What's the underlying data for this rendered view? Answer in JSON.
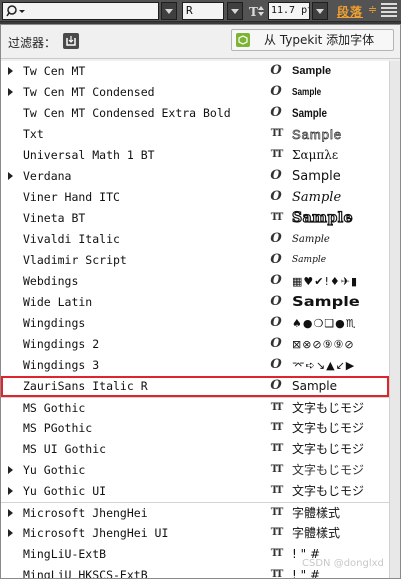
{
  "toolbar": {
    "font_search_value": "",
    "style_value": "R",
    "size_value": "11.7 pt",
    "paragraph_label": "段落",
    "paragraph_arrow": "≑"
  },
  "filter": {
    "label": "过滤器：",
    "typekit_button": "从 Typekit 添加字体"
  },
  "fonts": [
    {
      "name": "Tw Cen MT",
      "expandable": true,
      "type": "O",
      "sample": "Sample",
      "sample_style": "bold-sans"
    },
    {
      "name": "Tw Cen MT Condensed",
      "expandable": true,
      "type": "O",
      "sample": "Sample",
      "sample_style": "condensed"
    },
    {
      "name": "Tw Cen MT Condensed Extra Bold",
      "expandable": false,
      "type": "O",
      "sample": "Sample",
      "sample_style": "condensed-bold"
    },
    {
      "name": "Txt",
      "expandable": false,
      "type": "TT",
      "sample": "Sample",
      "sample_style": "outline"
    },
    {
      "name": "Universal Math 1 BT",
      "expandable": false,
      "type": "TT",
      "sample": "Σαμπλε",
      "sample_style": "greek"
    },
    {
      "name": "Verdana",
      "expandable": true,
      "type": "O",
      "sample": "Sample",
      "sample_style": "verdana"
    },
    {
      "name": "Viner Hand ITC",
      "expandable": false,
      "type": "O",
      "sample": "Sample",
      "sample_style": "hand"
    },
    {
      "name": "Vineta BT",
      "expandable": false,
      "type": "TT",
      "sample": "Sample",
      "sample_style": "vineta"
    },
    {
      "name": "Vivaldi Italic",
      "expandable": false,
      "type": "O",
      "sample": "Sample",
      "sample_style": "script-small"
    },
    {
      "name": "Vladimir Script",
      "expandable": false,
      "type": "O",
      "sample": "Sample",
      "sample_style": "script-tiny"
    },
    {
      "name": "Webdings",
      "expandable": false,
      "type": "O",
      "sample": "▦♥✔!♦✈▮",
      "sample_style": "symbols"
    },
    {
      "name": "Wide Latin",
      "expandable": false,
      "type": "O",
      "sample": "Sample",
      "sample_style": "wide"
    },
    {
      "name": "Wingdings",
      "expandable": false,
      "type": "O",
      "sample": "♠●❍❑●♏",
      "sample_style": "symbols"
    },
    {
      "name": "Wingdings 2",
      "expandable": false,
      "type": "O",
      "sample": "⊠⊗⊘⑨⑨⊘",
      "sample_style": "symbols"
    },
    {
      "name": "Wingdings 3",
      "expandable": false,
      "type": "O",
      "sample": "⌤➪↘▲↙▶",
      "sample_style": "symbols"
    },
    {
      "name": "ZauriSans Italic R",
      "expandable": false,
      "type": "O",
      "sample": "Sample",
      "sample_style": "plain",
      "selected": true
    },
    {
      "name": "MS Gothic",
      "expandable": false,
      "type": "TT",
      "sample": "文字もじモジ",
      "sample_style": "cjk",
      "separator": true
    },
    {
      "name": "MS PGothic",
      "expandable": false,
      "type": "TT",
      "sample": "文字もじモジ",
      "sample_style": "cjk"
    },
    {
      "name": "MS UI Gothic",
      "expandable": false,
      "type": "TT",
      "sample": "文字もじモジ",
      "sample_style": "cjk"
    },
    {
      "name": "Yu Gothic",
      "expandable": true,
      "type": "TT",
      "sample": "文字もじモジ",
      "sample_style": "cjk-light"
    },
    {
      "name": "Yu Gothic UI",
      "expandable": true,
      "type": "TT",
      "sample": "文字もじモジ",
      "sample_style": "cjk"
    },
    {
      "name": "Microsoft JhengHei",
      "expandable": true,
      "type": "TT",
      "sample": "字體樣式",
      "sample_style": "cjk",
      "separator": true
    },
    {
      "name": "Microsoft JhengHei UI",
      "expandable": true,
      "type": "TT",
      "sample": "字體樣式",
      "sample_style": "cjk"
    },
    {
      "name": "MingLiU-ExtB",
      "expandable": false,
      "type": "TT",
      "sample": "! \" #",
      "sample_style": "plain"
    },
    {
      "name": "MingLiU HKSCS-ExtB",
      "expandable": false,
      "type": "TT",
      "sample": "! \" #",
      "sample_style": "plain"
    }
  ],
  "watermark": "CSDN @donglxd",
  "colors": {
    "selection_outline": "#e0242e",
    "paragraph_accent": "#f0a030",
    "typekit_green": "#7fb336"
  }
}
